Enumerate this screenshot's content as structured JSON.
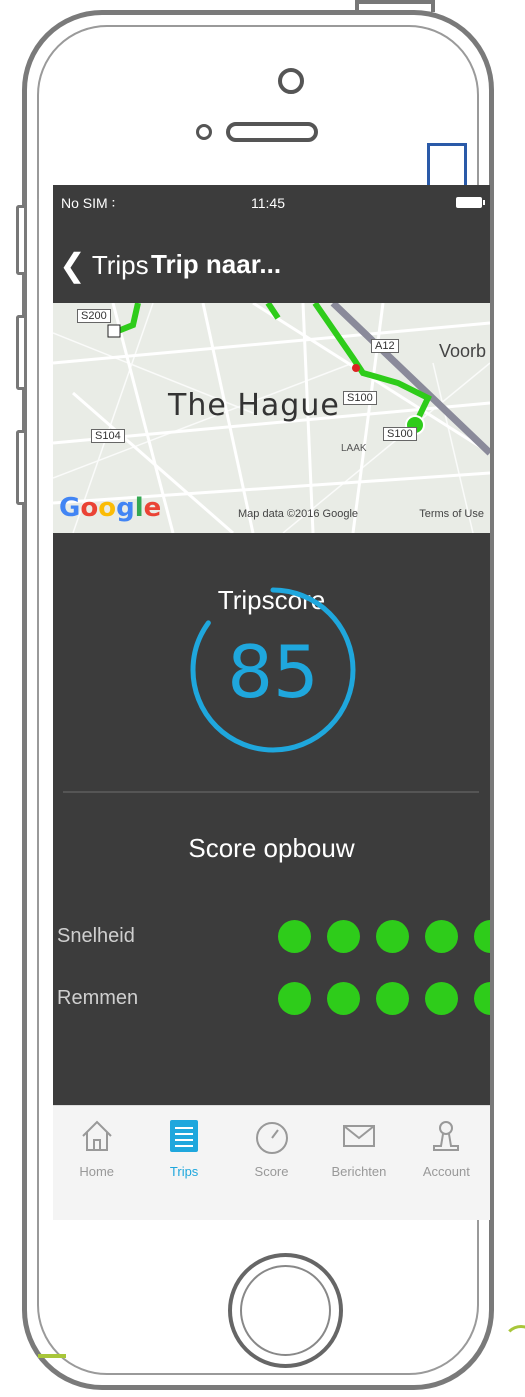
{
  "status": {
    "carrier": "No SIM",
    "time": "11:45"
  },
  "nav": {
    "back_label": "Trips",
    "title": "Trip naar..."
  },
  "map": {
    "city": "The Hague",
    "neighborhood_right": "Voorb",
    "road_labels": [
      "S200",
      "S104",
      "S100",
      "S100",
      "A12"
    ],
    "small_labels": [
      "LAAK"
    ],
    "attribution": "Map data ©2016 Google",
    "terms": "Terms of Use"
  },
  "trip_score": {
    "title": "Tripscore",
    "value": "85",
    "progress": 0.85
  },
  "score_build": {
    "title": "Score opbouw",
    "rows": [
      {
        "label": "Snelheid",
        "dots": 5
      },
      {
        "label": "Remmen",
        "dots": 5
      }
    ]
  },
  "tabbar": {
    "items": [
      {
        "label": "Home",
        "icon": "home-icon"
      },
      {
        "label": "Trips",
        "icon": "list-icon",
        "active": true
      },
      {
        "label": "Score",
        "icon": "speedometer-icon"
      },
      {
        "label": "Berichten",
        "icon": "envelope-icon"
      },
      {
        "label": "Account",
        "icon": "person-icon"
      }
    ]
  },
  "colors": {
    "accent": "#1fa7dd",
    "route_green": "#2ecc1a",
    "screen_bg": "#3c3c3c"
  }
}
